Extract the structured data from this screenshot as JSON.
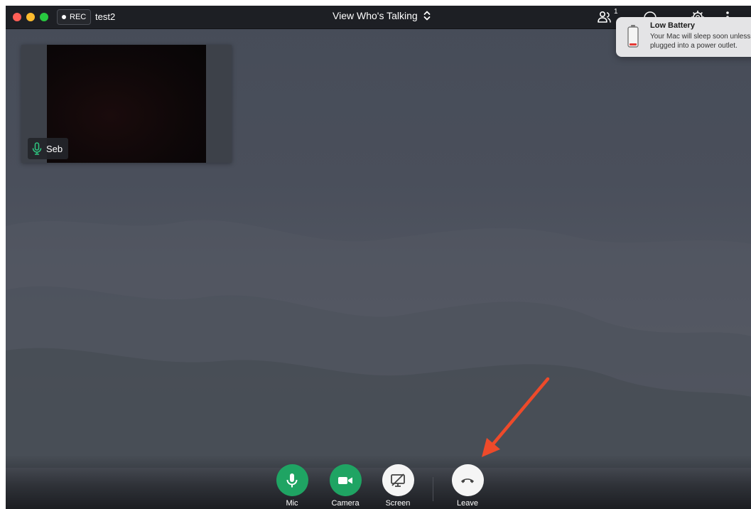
{
  "topbar": {
    "rec_label": "REC",
    "room_name": "test2",
    "view_mode": "View Who's Talking",
    "participant_count": "1"
  },
  "participants": [
    {
      "name": "Seb",
      "mic_on": true
    }
  ],
  "notification": {
    "title": "Low Battery",
    "body": "Your Mac will sleep soon unless plugged into a power outlet."
  },
  "controls": {
    "mic": "Mic",
    "camera": "Camera",
    "screen": "Screen",
    "leave": "Leave"
  },
  "colors": {
    "control_green": "#1fa463",
    "annotation_arrow": "#ee4a2a",
    "battery_low": "#e53935"
  }
}
